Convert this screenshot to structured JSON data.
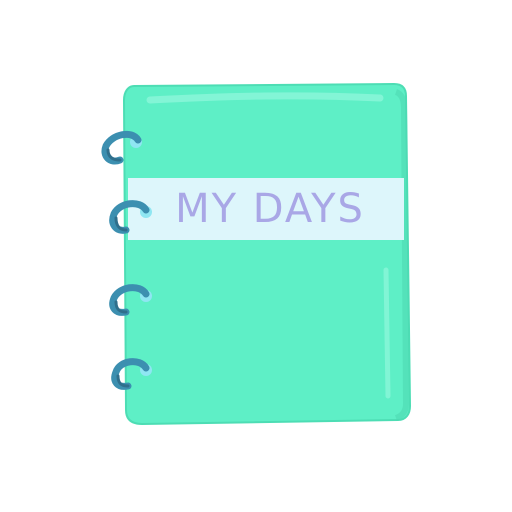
{
  "notebook": {
    "label_text": "MY DAYS",
    "icon": "spiral-notebook-icon",
    "colors": {
      "cover": "#5EEFC6",
      "cover_edge": "#4DDDB4",
      "cover_highlight": "#8AF6D8",
      "label_band": "#DDF6FB",
      "label_text": "#A9A7E6",
      "ring": "#3C8FB0",
      "ring_dark": "#2F6F8C",
      "hole": "#8FE6F2",
      "background": "#FFFFFF"
    }
  }
}
